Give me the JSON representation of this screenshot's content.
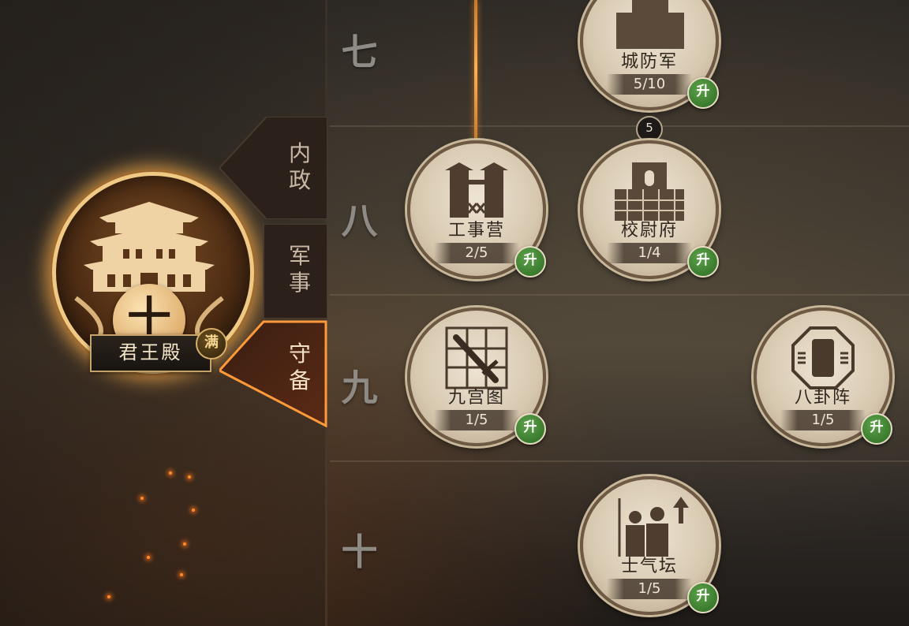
{
  "hall": {
    "name": "君王殿",
    "level_glyph": "十",
    "status_badge": "满"
  },
  "tabs": [
    {
      "label_line1": "内",
      "label_line2": "政",
      "active": false
    },
    {
      "label_line1": "军",
      "label_line2": "事",
      "active": false
    },
    {
      "label_line1": "守",
      "label_line2": "备",
      "active": true
    }
  ],
  "rows": [
    {
      "label": "七"
    },
    {
      "label": "八"
    },
    {
      "label": "九"
    },
    {
      "label": "十"
    }
  ],
  "nodes": [
    {
      "id": "city-guard",
      "name": "城防军",
      "level": "5/10",
      "upgrade": "升",
      "icon": "soldiers-icon"
    },
    {
      "id": "engineer-camp",
      "name": "工事营",
      "level": "2/5",
      "upgrade": "升",
      "icon": "fortified-gate-icon"
    },
    {
      "id": "commandant-office",
      "name": "校尉府",
      "level": "1/4",
      "upgrade": "升",
      "icon": "city-wall-icon"
    },
    {
      "id": "nine-palace",
      "name": "九宫图",
      "level": "1/5",
      "upgrade": "升",
      "icon": "sword-grid-icon"
    },
    {
      "id": "bagua-formation",
      "name": "八卦阵",
      "level": "1/5",
      "upgrade": "升",
      "icon": "bagua-icon"
    },
    {
      "id": "morale-altar",
      "name": "士气坛",
      "level": "1/5",
      "upgrade": "升",
      "icon": "morale-soldiers-icon"
    }
  ],
  "requirement_badge": "5",
  "colors": {
    "active_tab_glow": "#e8802a",
    "upgrade_badge": "#3f8a32",
    "node_disc": "#ddd0b8",
    "connector": "#ffb050"
  }
}
